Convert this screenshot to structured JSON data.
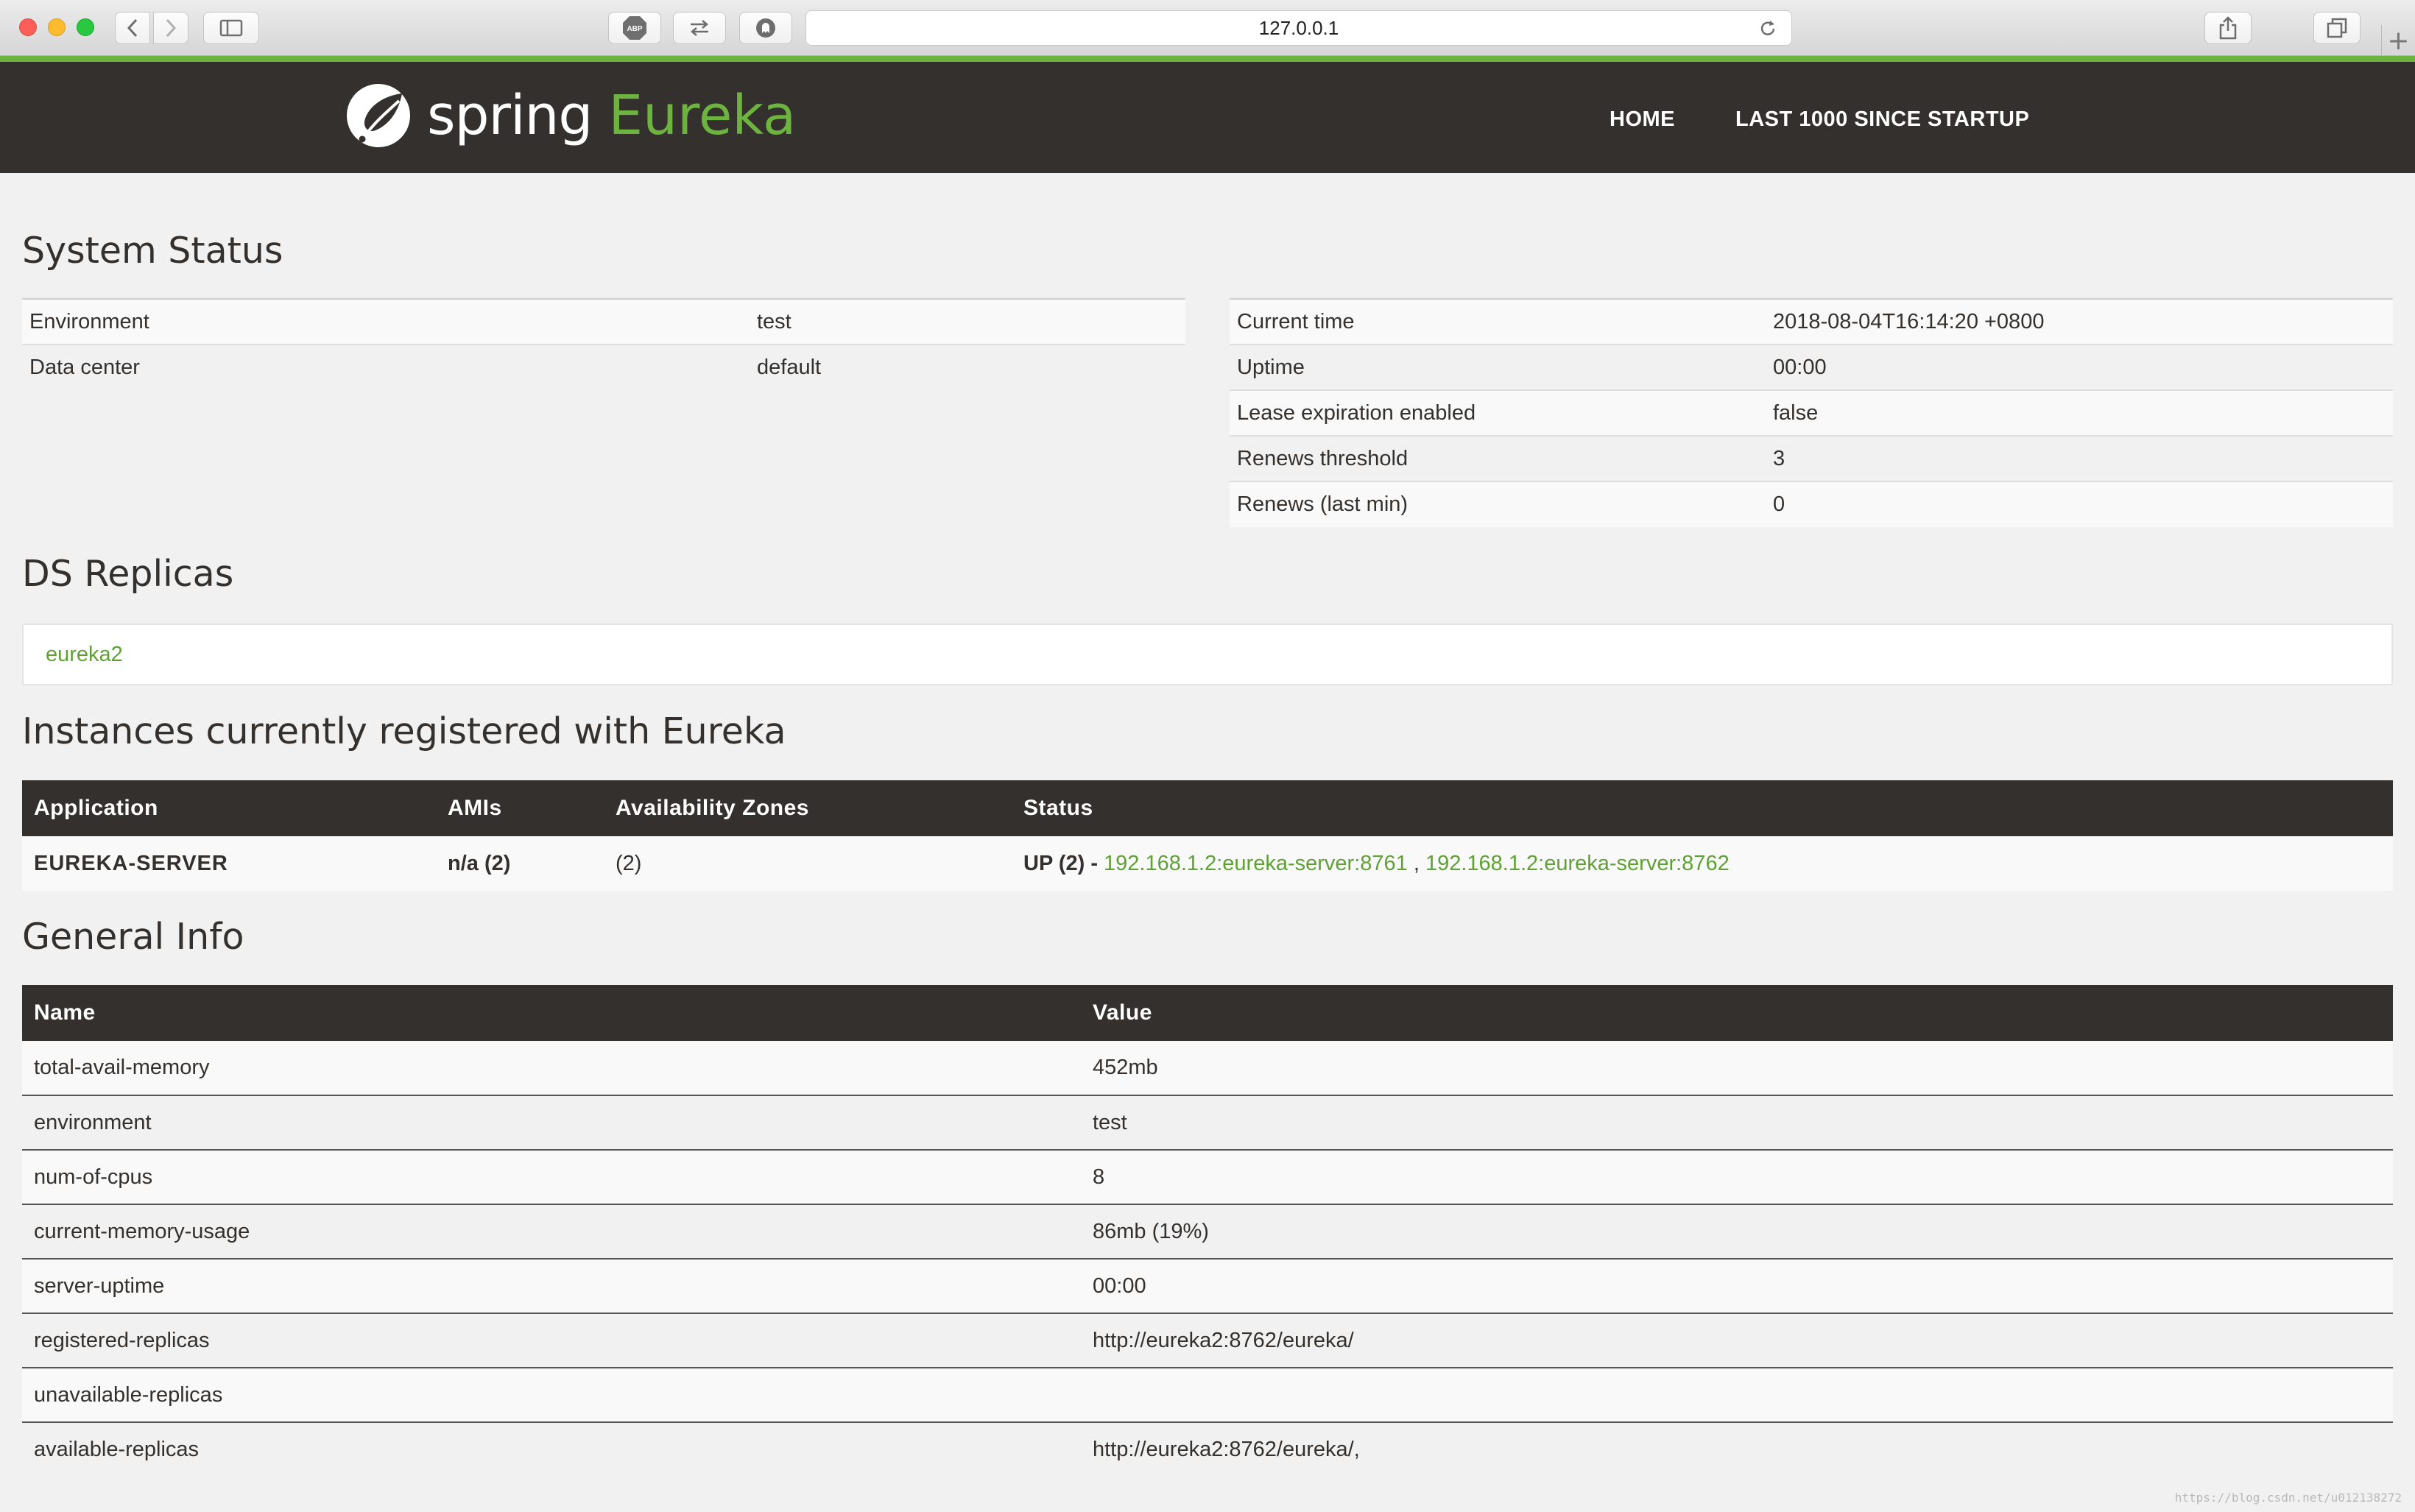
{
  "browser": {
    "url": "127.0.0.1",
    "new_tab": "+"
  },
  "header": {
    "logo_spring": "spring",
    "logo_eureka": "Eureka",
    "nav": [
      {
        "label": "HOME"
      },
      {
        "label": "LAST 1000 SINCE STARTUP"
      }
    ]
  },
  "system_status": {
    "title": "System Status",
    "left": [
      {
        "name": "Environment",
        "value": "test"
      },
      {
        "name": "Data center",
        "value": "default"
      }
    ],
    "right": [
      {
        "name": "Current time",
        "value": "2018-08-04T16:14:20 +0800"
      },
      {
        "name": "Uptime",
        "value": "00:00"
      },
      {
        "name": "Lease expiration enabled",
        "value": "false"
      },
      {
        "name": "Renews threshold",
        "value": "3"
      },
      {
        "name": "Renews (last min)",
        "value": "0"
      }
    ]
  },
  "ds_replicas": {
    "title": "DS Replicas",
    "items": [
      "eureka2"
    ]
  },
  "instances": {
    "title": "Instances currently registered with Eureka",
    "columns": [
      "Application",
      "AMIs",
      "Availability Zones",
      "Status"
    ],
    "rows": [
      {
        "application": "EUREKA-SERVER",
        "amis": "n/a (2)",
        "zones": "(2)",
        "status_prefix": "UP (2) -",
        "links": [
          "192.168.1.2:eureka-server:8761",
          "192.168.1.2:eureka-server:8762"
        ],
        "separator": ","
      }
    ]
  },
  "general_info": {
    "title": "General Info",
    "columns": [
      "Name",
      "Value"
    ],
    "rows": [
      {
        "name": "total-avail-memory",
        "value": "452mb"
      },
      {
        "name": "environment",
        "value": "test"
      },
      {
        "name": "num-of-cpus",
        "value": "8"
      },
      {
        "name": "current-memory-usage",
        "value": "86mb (19%)"
      },
      {
        "name": "server-uptime",
        "value": "00:00"
      },
      {
        "name": "registered-replicas",
        "value": "http://eureka2:8762/eureka/"
      },
      {
        "name": "unavailable-replicas",
        "value": ""
      },
      {
        "name": "available-replicas",
        "value": "http://eureka2:8762/eureka/,"
      }
    ]
  },
  "watermark": "https://blog.csdn.net/u012138272"
}
